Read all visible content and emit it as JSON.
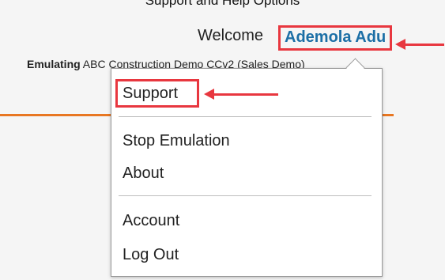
{
  "top_partial_text": "Support and Help Options",
  "header": {
    "welcome_prefix": "Welcome",
    "username": "Ademola Adu"
  },
  "emulation": {
    "label": "Emulating",
    "account": "ABC Construction Demo CCv2 (Sales Demo)"
  },
  "menu": {
    "items": [
      {
        "label": "Support"
      },
      {
        "label": "Stop Emulation"
      },
      {
        "label": "About"
      },
      {
        "label": "Account"
      },
      {
        "label": "Log Out"
      }
    ]
  },
  "colors": {
    "highlight": "#e8373f",
    "link": "#1c6fa6",
    "accent": "#e87722"
  }
}
